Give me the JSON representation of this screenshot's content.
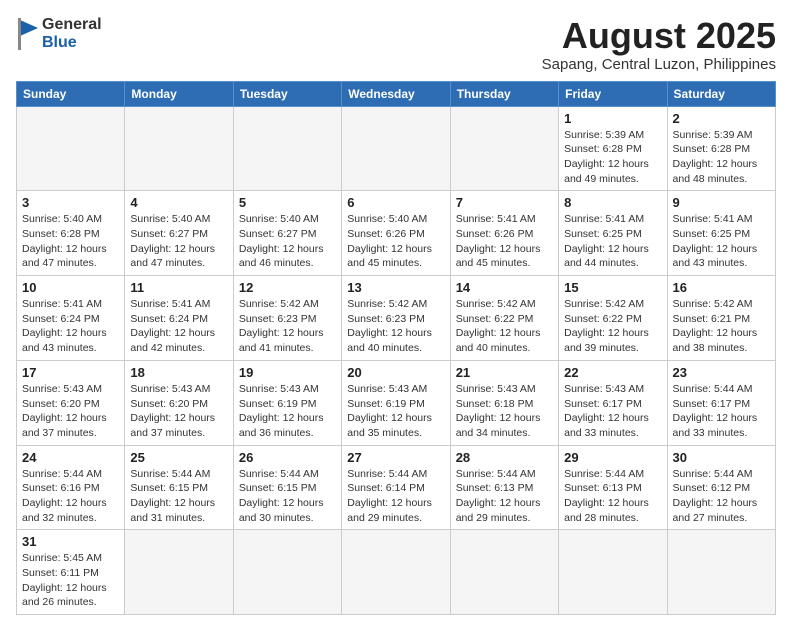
{
  "header": {
    "logo_general": "General",
    "logo_blue": "Blue",
    "month_year": "August 2025",
    "location": "Sapang, Central Luzon, Philippines"
  },
  "days_of_week": [
    "Sunday",
    "Monday",
    "Tuesday",
    "Wednesday",
    "Thursday",
    "Friday",
    "Saturday"
  ],
  "weeks": [
    [
      {
        "num": "",
        "info": ""
      },
      {
        "num": "",
        "info": ""
      },
      {
        "num": "",
        "info": ""
      },
      {
        "num": "",
        "info": ""
      },
      {
        "num": "",
        "info": ""
      },
      {
        "num": "1",
        "info": "Sunrise: 5:39 AM\nSunset: 6:28 PM\nDaylight: 12 hours\nand 49 minutes."
      },
      {
        "num": "2",
        "info": "Sunrise: 5:39 AM\nSunset: 6:28 PM\nDaylight: 12 hours\nand 48 minutes."
      }
    ],
    [
      {
        "num": "3",
        "info": "Sunrise: 5:40 AM\nSunset: 6:28 PM\nDaylight: 12 hours\nand 47 minutes."
      },
      {
        "num": "4",
        "info": "Sunrise: 5:40 AM\nSunset: 6:27 PM\nDaylight: 12 hours\nand 47 minutes."
      },
      {
        "num": "5",
        "info": "Sunrise: 5:40 AM\nSunset: 6:27 PM\nDaylight: 12 hours\nand 46 minutes."
      },
      {
        "num": "6",
        "info": "Sunrise: 5:40 AM\nSunset: 6:26 PM\nDaylight: 12 hours\nand 45 minutes."
      },
      {
        "num": "7",
        "info": "Sunrise: 5:41 AM\nSunset: 6:26 PM\nDaylight: 12 hours\nand 45 minutes."
      },
      {
        "num": "8",
        "info": "Sunrise: 5:41 AM\nSunset: 6:25 PM\nDaylight: 12 hours\nand 44 minutes."
      },
      {
        "num": "9",
        "info": "Sunrise: 5:41 AM\nSunset: 6:25 PM\nDaylight: 12 hours\nand 43 minutes."
      }
    ],
    [
      {
        "num": "10",
        "info": "Sunrise: 5:41 AM\nSunset: 6:24 PM\nDaylight: 12 hours\nand 43 minutes."
      },
      {
        "num": "11",
        "info": "Sunrise: 5:41 AM\nSunset: 6:24 PM\nDaylight: 12 hours\nand 42 minutes."
      },
      {
        "num": "12",
        "info": "Sunrise: 5:42 AM\nSunset: 6:23 PM\nDaylight: 12 hours\nand 41 minutes."
      },
      {
        "num": "13",
        "info": "Sunrise: 5:42 AM\nSunset: 6:23 PM\nDaylight: 12 hours\nand 40 minutes."
      },
      {
        "num": "14",
        "info": "Sunrise: 5:42 AM\nSunset: 6:22 PM\nDaylight: 12 hours\nand 40 minutes."
      },
      {
        "num": "15",
        "info": "Sunrise: 5:42 AM\nSunset: 6:22 PM\nDaylight: 12 hours\nand 39 minutes."
      },
      {
        "num": "16",
        "info": "Sunrise: 5:42 AM\nSunset: 6:21 PM\nDaylight: 12 hours\nand 38 minutes."
      }
    ],
    [
      {
        "num": "17",
        "info": "Sunrise: 5:43 AM\nSunset: 6:20 PM\nDaylight: 12 hours\nand 37 minutes."
      },
      {
        "num": "18",
        "info": "Sunrise: 5:43 AM\nSunset: 6:20 PM\nDaylight: 12 hours\nand 37 minutes."
      },
      {
        "num": "19",
        "info": "Sunrise: 5:43 AM\nSunset: 6:19 PM\nDaylight: 12 hours\nand 36 minutes."
      },
      {
        "num": "20",
        "info": "Sunrise: 5:43 AM\nSunset: 6:19 PM\nDaylight: 12 hours\nand 35 minutes."
      },
      {
        "num": "21",
        "info": "Sunrise: 5:43 AM\nSunset: 6:18 PM\nDaylight: 12 hours\nand 34 minutes."
      },
      {
        "num": "22",
        "info": "Sunrise: 5:43 AM\nSunset: 6:17 PM\nDaylight: 12 hours\nand 33 minutes."
      },
      {
        "num": "23",
        "info": "Sunrise: 5:44 AM\nSunset: 6:17 PM\nDaylight: 12 hours\nand 33 minutes."
      }
    ],
    [
      {
        "num": "24",
        "info": "Sunrise: 5:44 AM\nSunset: 6:16 PM\nDaylight: 12 hours\nand 32 minutes."
      },
      {
        "num": "25",
        "info": "Sunrise: 5:44 AM\nSunset: 6:15 PM\nDaylight: 12 hours\nand 31 minutes."
      },
      {
        "num": "26",
        "info": "Sunrise: 5:44 AM\nSunset: 6:15 PM\nDaylight: 12 hours\nand 30 minutes."
      },
      {
        "num": "27",
        "info": "Sunrise: 5:44 AM\nSunset: 6:14 PM\nDaylight: 12 hours\nand 29 minutes."
      },
      {
        "num": "28",
        "info": "Sunrise: 5:44 AM\nSunset: 6:13 PM\nDaylight: 12 hours\nand 29 minutes."
      },
      {
        "num": "29",
        "info": "Sunrise: 5:44 AM\nSunset: 6:13 PM\nDaylight: 12 hours\nand 28 minutes."
      },
      {
        "num": "30",
        "info": "Sunrise: 5:44 AM\nSunset: 6:12 PM\nDaylight: 12 hours\nand 27 minutes."
      }
    ],
    [
      {
        "num": "31",
        "info": "Sunrise: 5:45 AM\nSunset: 6:11 PM\nDaylight: 12 hours\nand 26 minutes."
      },
      {
        "num": "",
        "info": ""
      },
      {
        "num": "",
        "info": ""
      },
      {
        "num": "",
        "info": ""
      },
      {
        "num": "",
        "info": ""
      },
      {
        "num": "",
        "info": ""
      },
      {
        "num": "",
        "info": ""
      }
    ]
  ]
}
